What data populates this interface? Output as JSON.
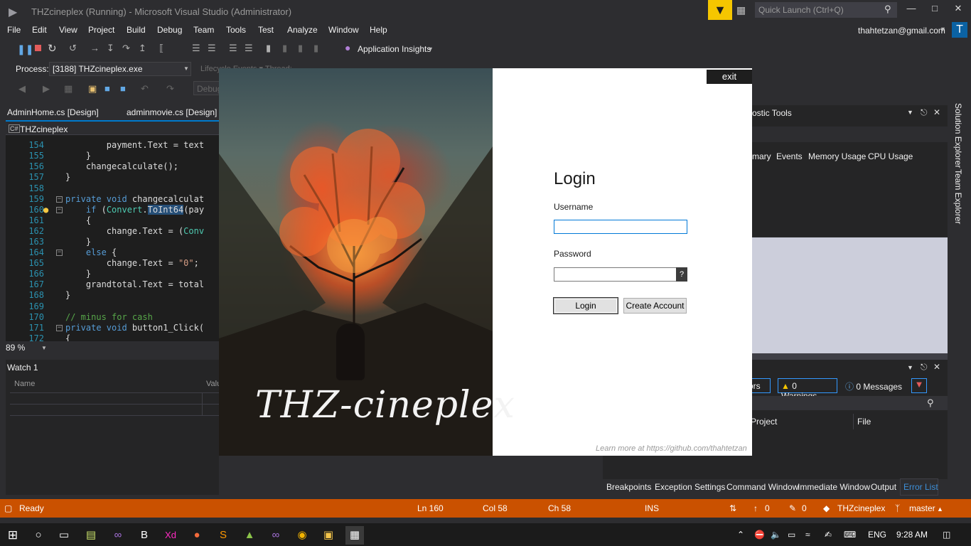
{
  "window": {
    "title": "THZcineplex (Running) - Microsoft Visual Studio  (Administrator)",
    "quick_launch_placeholder": "Quick Launch (Ctrl+Q)",
    "account": "thahtetzan@gmail.com",
    "avatar_letter": "T"
  },
  "menu": [
    "File",
    "Edit",
    "View",
    "Project",
    "Build",
    "Debug",
    "Team",
    "Tools",
    "Test",
    "Analyze",
    "Window",
    "Help"
  ],
  "toolbar": {
    "app_insights": "Application Insights",
    "process_label": "Process:",
    "process_value": "[3188] THZcineplex.exe",
    "lifecycle": "Lifecycle Events  ▾ Thread:",
    "debug_placeholder": "Debug"
  },
  "doc_tabs": [
    "AdminHome.cs [Design]",
    "adminmovie.cs [Design]"
  ],
  "editor": {
    "project": "THZcineplex",
    "line_numbers": [
      "154",
      "155",
      "156",
      "157",
      "158",
      "159",
      "160",
      "161",
      "162",
      "163",
      "164",
      "165",
      "166",
      "167",
      "168",
      "169",
      "170",
      "171",
      "172"
    ],
    "zoom": "89 %"
  },
  "watch": {
    "title": "Watch 1",
    "col_name": "Name",
    "col_value": "Valu"
  },
  "diagnostics": {
    "title": "ostic Tools",
    "tabs": [
      "mary",
      "Events",
      "Memory Usage",
      "CPU Usage"
    ]
  },
  "side_tabs": [
    "Solution Explorer",
    "Team Explorer"
  ],
  "error_list": {
    "errors": "rors",
    "warnings": "0 Warnings",
    "messages": "0 Messages",
    "col_project": "Project",
    "col_file": "File"
  },
  "bottom_tabs": [
    "Breakpoints",
    "Exception Settings",
    "Command Window",
    "Immediate Window",
    "Output",
    "Error List"
  ],
  "status": {
    "ready": "Ready",
    "ln": "Ln 160",
    "col": "Col 58",
    "ch": "Ch 58",
    "ins": "INS",
    "up": "0",
    "pen": "0",
    "repo": "THZcineplex",
    "branch": "master"
  },
  "taskbar": {
    "lang": "ENG",
    "time": "9:28 AM"
  },
  "login": {
    "exit": "exit",
    "title": "Login",
    "username_label": "Username",
    "username_value": "",
    "password_label": "Password",
    "help": "?",
    "login_button": "Login",
    "create_button": "Create Account",
    "learn_more": "Learn more at https://github.com/thahtetzan",
    "brand": "THZ-cineplex"
  },
  "colors": {
    "accent": "#ca5100",
    "vs_dark": "#2d2d30",
    "editor_bg": "#1e1e1e",
    "selection": "#3399ff"
  }
}
